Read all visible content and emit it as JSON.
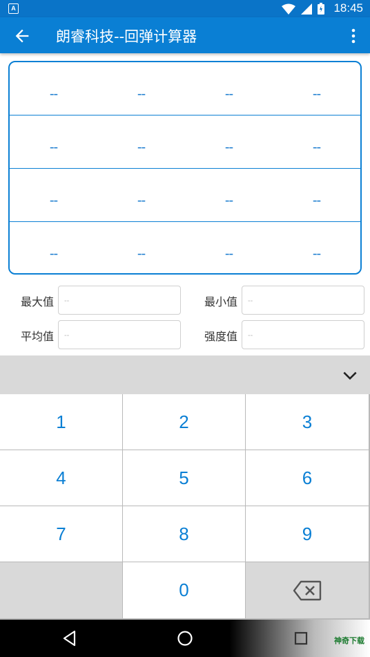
{
  "status_bar": {
    "time": "18:45",
    "app_badge": "A"
  },
  "app_bar": {
    "title": "朗睿科技--回弹计算器"
  },
  "grid": {
    "rows": [
      [
        "--",
        "--",
        "--",
        "--"
      ],
      [
        "--",
        "--",
        "--",
        "--"
      ],
      [
        "--",
        "--",
        "--",
        "--"
      ],
      [
        "--",
        "--",
        "--",
        "--"
      ]
    ]
  },
  "stats": {
    "max_label": "最大值",
    "max_placeholder": "--",
    "min_label": "最小值",
    "min_placeholder": "--",
    "avg_label": "平均值",
    "avg_placeholder": "--",
    "strength_label": "强度值",
    "strength_placeholder": "--"
  },
  "keypad": {
    "keys": [
      "1",
      "2",
      "3",
      "4",
      "5",
      "6",
      "7",
      "8",
      "9",
      "",
      "0"
    ]
  },
  "watermark": "神奇下载",
  "colors": {
    "primary": "#0a7fd4",
    "status_bar": "#0a74c8",
    "keypad_grey": "#d9d9d9"
  },
  "icons": {
    "back": "arrow-left-icon",
    "more": "more-vert-icon",
    "collapse": "chevron-down-icon",
    "backspace": "backspace-icon",
    "nav_back": "triangle-back-icon",
    "nav_home": "circle-home-icon",
    "nav_recents": "square-recents-icon"
  }
}
